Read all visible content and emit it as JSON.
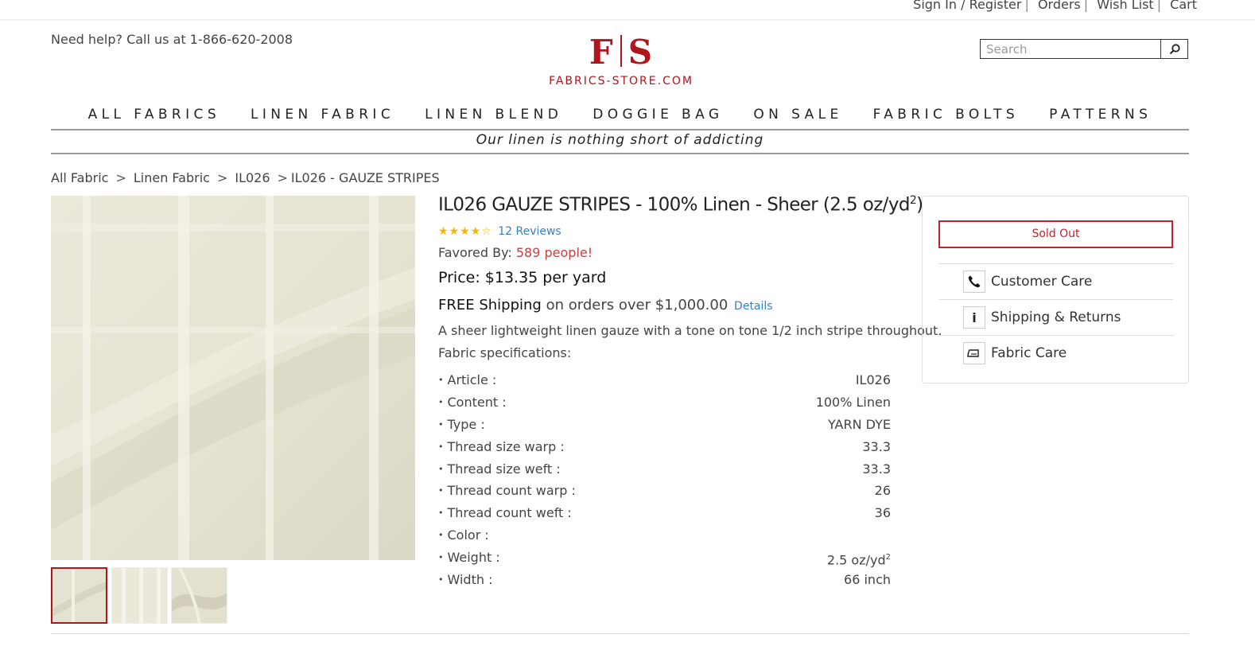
{
  "top_links": [
    "Sign In / Register",
    "Orders",
    "Wish List",
    "Cart"
  ],
  "help_text": "Need help? Call us at 1-866-620-2008",
  "logo": {
    "left": "F",
    "right": "S",
    "name": "FABRICS-STORE.COM"
  },
  "search": {
    "placeholder": "Search"
  },
  "nav": [
    "ALL FABRICS",
    "LINEN FABRIC",
    "LINEN BLEND",
    "DOGGIE BAG",
    "ON SALE",
    "FABRIC BOLTS",
    "PATTERNS"
  ],
  "tagline": "Our linen is nothing short of addicting",
  "breadcrumb": [
    "All Fabric",
    "Linen Fabric",
    "IL026",
    "IL026 - GAUZE STRIPES"
  ],
  "product": {
    "title_main": "IL026 GAUZE STRIPES - 100% Linen - Sheer (2.5 oz/yd",
    "title_sup": "2",
    "title_end": ")",
    "rating_stars": 4,
    "reviews": "12 Reviews",
    "favored_label": "Favored By:",
    "favored_count": "589 people!",
    "price": "Price: $13.35 per yard",
    "shipping_bold": "FREE Shipping",
    "shipping_rest": "on orders over $1,000.00",
    "shipping_link": "Details",
    "description": "A sheer lightweight linen gauze with a tone on tone 1/2 inch stripe throughout.",
    "specs_label": "Fabric specifications:",
    "specs": [
      {
        "k": "Article :",
        "v": "IL026"
      },
      {
        "k": "Content :",
        "v": "100% Linen"
      },
      {
        "k": "Type :",
        "v": "YARN DYE"
      },
      {
        "k": "Thread size warp :",
        "v": "33.3"
      },
      {
        "k": "Thread size weft :",
        "v": "33.3"
      },
      {
        "k": "Thread count warp :",
        "v": "26"
      },
      {
        "k": "Thread count weft :",
        "v": "36"
      },
      {
        "k": "Color :",
        "v": ""
      },
      {
        "k": "Weight :",
        "v": "2.5 oz/yd",
        "sup": "2"
      },
      {
        "k": "Width :",
        "v": "66 inch"
      }
    ]
  },
  "sidebox": {
    "sold_out": "Sold Out",
    "items": [
      {
        "label": "Customer Care",
        "icon": "phone-icon"
      },
      {
        "label": "Shipping & Returns",
        "icon": "info-icon"
      },
      {
        "label": "Fabric Care",
        "icon": "iron-icon"
      }
    ]
  },
  "colors": {
    "brand_red": "#b0141c",
    "link_blue": "#3a7ec2",
    "star_gold": "#f3b50c",
    "fabric": "#e8e4d4"
  }
}
